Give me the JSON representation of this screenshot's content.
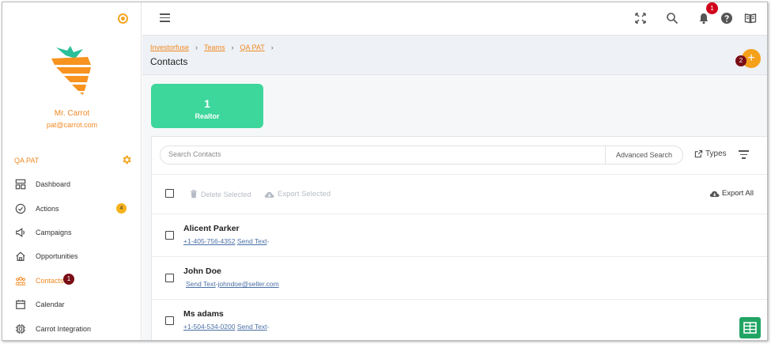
{
  "user": {
    "name": "Mr. Carrot",
    "email": "pat@carrot.com"
  },
  "team": {
    "label": "QA PAT"
  },
  "colors": {
    "accent": "#f08a24",
    "realtor_card": "#3dd69b",
    "step_badge": "#7a0d16",
    "notification": "#d0021b"
  },
  "nav": {
    "items": [
      {
        "label": "Dashboard",
        "icon": "dashboard-icon"
      },
      {
        "label": "Actions",
        "icon": "check-circle-icon",
        "badge": "4"
      },
      {
        "label": "Campaigns",
        "icon": "megaphone-icon"
      },
      {
        "label": "Opportunities",
        "icon": "home-icon"
      },
      {
        "label": "Contacts",
        "icon": "contacts-icon",
        "step": "1"
      },
      {
        "label": "Calendar",
        "icon": "calendar-icon"
      },
      {
        "label": "Carrot Integration",
        "icon": "chip-icon"
      }
    ]
  },
  "topbar": {
    "notification_count": "1"
  },
  "header": {
    "breadcrumb": [
      "Investorfuse",
      "Teams",
      "QA PAT"
    ],
    "title": "Contacts",
    "add_step": "2",
    "add_label": "+"
  },
  "summary": {
    "count": "1",
    "label": "Realtor"
  },
  "search": {
    "placeholder": "Search Contacts",
    "advanced": "Advanced Search",
    "types": "Types"
  },
  "bulk": {
    "delete": "Delete Selected",
    "export": "Export Selected",
    "export_all": "Export All"
  },
  "contacts": [
    {
      "name": "Alicent Parker",
      "phone": "+1-405-756-4352",
      "send_text": "Send Text",
      "email": "",
      "suffix": "-"
    },
    {
      "name": "John Doe",
      "phone": "",
      "send_text": "Send Text",
      "email": "johndoe@seller.com",
      "suffix": "-"
    },
    {
      "name": "Ms adams",
      "phone": "+1-504-534-0200",
      "send_text": "Send Text",
      "email": "",
      "suffix": "-"
    }
  ]
}
